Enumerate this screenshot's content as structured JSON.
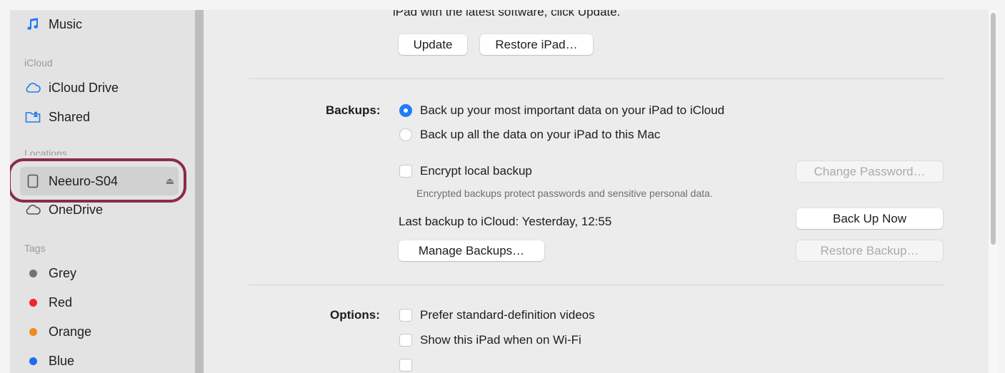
{
  "sidebar": {
    "music_label": "Music",
    "icloud_section": "iCloud",
    "icloud_drive_label": "iCloud Drive",
    "shared_label": "Shared",
    "locations_section": "Locations",
    "device_label": "Neeuro-S04",
    "onedrive_label": "OneDrive",
    "tags_section": "Tags",
    "tags": [
      {
        "label": "Grey",
        "color": "#737373"
      },
      {
        "label": "Red",
        "color": "#f0262a"
      },
      {
        "label": "Orange",
        "color": "#f08a1c"
      },
      {
        "label": "Blue",
        "color": "#1f6cf0"
      }
    ],
    "highlight_color": "#8a2a4e"
  },
  "software": {
    "clipped_text": "iPad with the latest software, click Update.",
    "update_button": "Update",
    "restore_button": "Restore iPad…"
  },
  "backups": {
    "label": "Backups:",
    "option_icloud": "Back up your most important data on your iPad to iCloud",
    "option_mac": "Back up all the data on your iPad to this Mac",
    "selected": "icloud",
    "encrypt_label": "Encrypt local backup",
    "encrypt_note": "Encrypted backups protect passwords and sensitive personal data.",
    "change_password_button": "Change Password…",
    "last_backup_text": "Last backup to iCloud:  Yesterday, 12:55",
    "back_up_now_button": "Back Up Now",
    "manage_backups_button": "Manage Backups…",
    "restore_backup_button": "Restore Backup…"
  },
  "options": {
    "label": "Options:",
    "items": [
      "Prefer standard-definition videos",
      "Show this iPad when on Wi-Fi"
    ]
  },
  "accent_color": "#1f7cf5"
}
